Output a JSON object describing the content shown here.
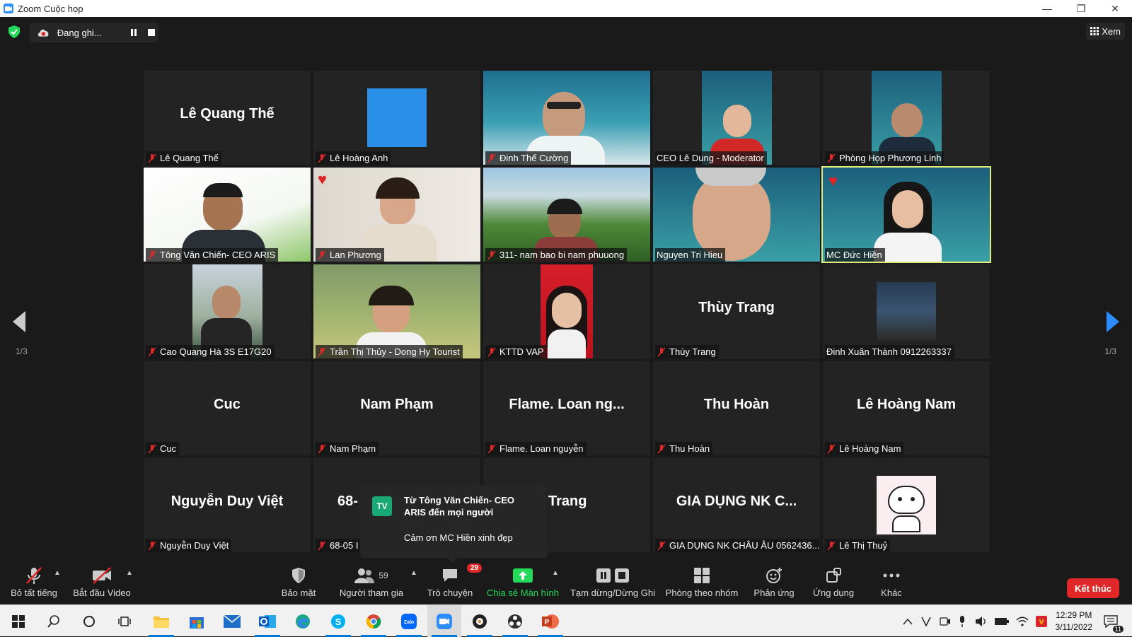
{
  "window": {
    "title": "Zoom Cuộc họp",
    "minimize": "—",
    "restore": "❐",
    "close": "✕"
  },
  "recording": {
    "status": "Đang ghi..."
  },
  "view_button": {
    "label": "Xem"
  },
  "pagination": {
    "left": "1/3",
    "right": "1/3"
  },
  "tiles": [
    {
      "name": "Lê Quang Thế",
      "label": "Lê Quang Thế",
      "big": "Lê Quang Thế"
    },
    {
      "name": "Lê Hoàng Anh",
      "label": "Lê Hoàng Anh"
    },
    {
      "name": "Đinh Thế Cường",
      "label": "Đinh Thế Cường"
    },
    {
      "name": "CEO Lê Dung - Moderator",
      "label": "CEO Lê Dung - Moderator"
    },
    {
      "name": "Phòng Họp Phương Linh",
      "label": "Phòng Họp Phương Linh"
    },
    {
      "name": "Tông Văn Chiến- CEO ARIS",
      "label": "Tông Văn Chiến- CEO ARIS"
    },
    {
      "name": "Lan Phương",
      "label": "Lan Phương"
    },
    {
      "name": "311- nam bao bi nam phuuong",
      "label": "311- nam bao bi nam phuuong"
    },
    {
      "name": "Nguyen Tri Hieu",
      "label": "Nguyen Tri Hieu"
    },
    {
      "name": "MC Đức Hiền",
      "label": "MC Đức Hiền"
    },
    {
      "name": "Cao Quang Hà 3S E17G20",
      "label": "Cao Quang Hà 3S E17G20"
    },
    {
      "name": "Trần Thị Thủy - Dong Hy Tourist",
      "label": "Trần Thị Thủy - Dong Hy Tourist"
    },
    {
      "name": "KTTD VAP",
      "label": "KTTD VAP"
    },
    {
      "name": "Thùy Trang",
      "label": "Thùy Trang",
      "big": "Thùy Trang"
    },
    {
      "name": "Đinh Xuân Thành 0912263337",
      "label": "Đinh Xuân Thành 0912263337"
    },
    {
      "name": "Cuc",
      "label": "Cuc",
      "big": "Cuc"
    },
    {
      "name": "Nam Phạm",
      "label": "Nam Phạm",
      "big": "Nam Phạm"
    },
    {
      "name": "Flame. Loan nguyễn",
      "label": "Flame. Loan nguyễn",
      "big": "Flame. Loan ng..."
    },
    {
      "name": "Thu Hoàn",
      "label": "Thu Hoàn",
      "big": "Thu Hoàn"
    },
    {
      "name": "Lê Hoàng Nam",
      "label": "Lê Hoàng Nam",
      "big": "Lê Hoàng Nam"
    },
    {
      "name": "Nguyễn Duy Việt",
      "label": "Nguyễn Duy Việt",
      "big": "Nguyễn Duy Việt"
    },
    {
      "name": "68-05",
      "label": "68-05 I",
      "big": "68-"
    },
    {
      "name": "Trang",
      "label": "",
      "big": "Trang"
    },
    {
      "name": "GIA DỤNG NK CHÂU ÂU 0562436...",
      "label": "GIA DỤNG NK CHÂU ÂU 0562436...",
      "big": "GIA DỤNG NK C..."
    },
    {
      "name": "Lê Thị Thuỷ",
      "label": "Lê Thị Thuỷ"
    }
  ],
  "chat_popup": {
    "initials": "TV",
    "from": "Từ Tông Văn Chiến- CEO ARIS đến mọi người",
    "message": "Cảm ơn MC Hiền xinh đẹp"
  },
  "toolbar": {
    "mute_all": "Bỏ tất tiếng",
    "start_video": "Bắt đầu Video",
    "security": "Bảo mật",
    "participants": "Người tham gia",
    "participants_count": "59",
    "chat": "Trò chuyện",
    "chat_badge": "29",
    "share_screen": "Chia sẻ Màn hình",
    "pause_stop_recording": "Tạm dừng/Dừng Ghi",
    "breakout_rooms": "Phòng theo nhóm",
    "reactions": "Phản ứng",
    "apps": "Ứng dụng",
    "more": "Khác",
    "end": "Kết thúc"
  },
  "taskbar": {
    "time": "12:29 PM",
    "date": "3/11/2022",
    "notif_count": "11"
  },
  "colors": {
    "active_speaker": "#e2ec7e",
    "end_button": "#e02828",
    "share_green": "#23d959",
    "zoom_blue": "#2d8cff"
  }
}
